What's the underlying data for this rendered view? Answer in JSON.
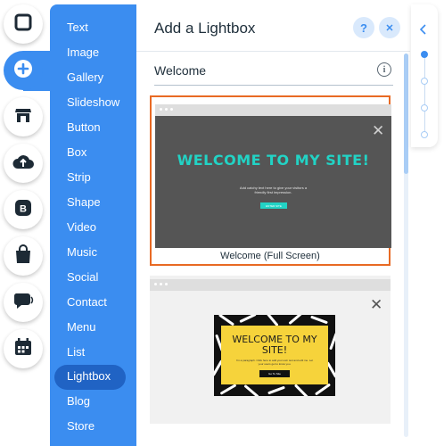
{
  "rail": {
    "items": [
      "square-shape-icon",
      "add-icon",
      "store-icon",
      "upload-icon",
      "blog-icon",
      "shopping-bag-icon",
      "chat-icon",
      "calendar-icon"
    ],
    "active_index": 1,
    "accent": "#3b8df0"
  },
  "menu": {
    "items": [
      {
        "label": "Text"
      },
      {
        "label": "Image"
      },
      {
        "label": "Gallery"
      },
      {
        "label": "Slideshow"
      },
      {
        "label": "Button"
      },
      {
        "label": "Box"
      },
      {
        "label": "Strip"
      },
      {
        "label": "Shape"
      },
      {
        "label": "Video"
      },
      {
        "label": "Music"
      },
      {
        "label": "Social"
      },
      {
        "label": "Contact"
      },
      {
        "label": "Menu"
      },
      {
        "label": "List"
      },
      {
        "label": "Lightbox"
      },
      {
        "label": "Blog"
      },
      {
        "label": "Store"
      }
    ],
    "selected_index": 14
  },
  "panel": {
    "title": "Add a Lightbox",
    "help_label": "?",
    "close_label": "✕",
    "search_value": "Welcome",
    "info_label": "i",
    "cards": [
      {
        "heading": "WELCOME TO MY SITE!",
        "subtext": "Add catchy text here to give your visitors a friendly first impression.",
        "button": "ENTER SITE",
        "label": "Welcome (Full Screen)",
        "selected": true,
        "highlight_color": "#e86a24"
      },
      {
        "heading": "WELCOME TO MY SITE!",
        "subtext": "I'm a paragraph. Click here to add your own text and edit me. Let your users get to know you.",
        "button": "Go To Site"
      }
    ]
  },
  "nav": {
    "collapse_icon": "chevron-left-icon",
    "dot_count": 4,
    "active_dot": 0
  }
}
